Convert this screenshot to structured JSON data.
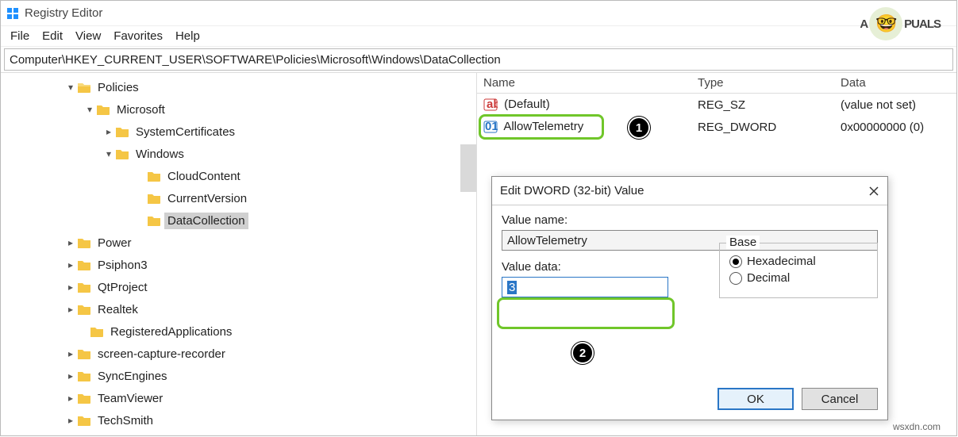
{
  "titlebar": {
    "title": "Registry Editor"
  },
  "menu": {
    "file": "File",
    "edit": "Edit",
    "view": "View",
    "favorites": "Favorites",
    "help": "Help"
  },
  "addressbar": "Computer\\HKEY_CURRENT_USER\\SOFTWARE\\Policies\\Microsoft\\Windows\\DataCollection",
  "tree": {
    "policies": "Policies",
    "microsoft": "Microsoft",
    "systemCertificates": "SystemCertificates",
    "windows": "Windows",
    "cloudContent": "CloudContent",
    "currentVersion": "CurrentVersion",
    "dataCollection": "DataCollection",
    "power": "Power",
    "psiphon3": "Psiphon3",
    "qtProject": "QtProject",
    "realtek": "Realtek",
    "registeredApplications": "RegisteredApplications",
    "screenCapture": "screen-capture-recorder",
    "syncEngines": "SyncEngines",
    "teamViewer": "TeamViewer",
    "techSmith": "TechSmith"
  },
  "list": {
    "header": {
      "name": "Name",
      "type": "Type",
      "data": "Data"
    },
    "rows": [
      {
        "name": "(Default)",
        "type": "REG_SZ",
        "data": "(value not set)"
      },
      {
        "name": "AllowTelemetry",
        "type": "REG_DWORD",
        "data": "0x00000000 (0)"
      }
    ]
  },
  "dialog": {
    "title": "Edit DWORD (32-bit) Value",
    "valueNameLabel": "Value name:",
    "valueName": "AllowTelemetry",
    "valueDataLabel": "Value data:",
    "valueData": "3",
    "baseLabel": "Base",
    "hex": "Hexadecimal",
    "dec": "Decimal",
    "ok": "OK",
    "cancel": "Cancel"
  },
  "annotations": {
    "marker1": "1",
    "marker2": "2"
  },
  "branding": {
    "logo_prefix": "A",
    "logo_rest": "PUALS",
    "site": "wsxdn.com"
  }
}
